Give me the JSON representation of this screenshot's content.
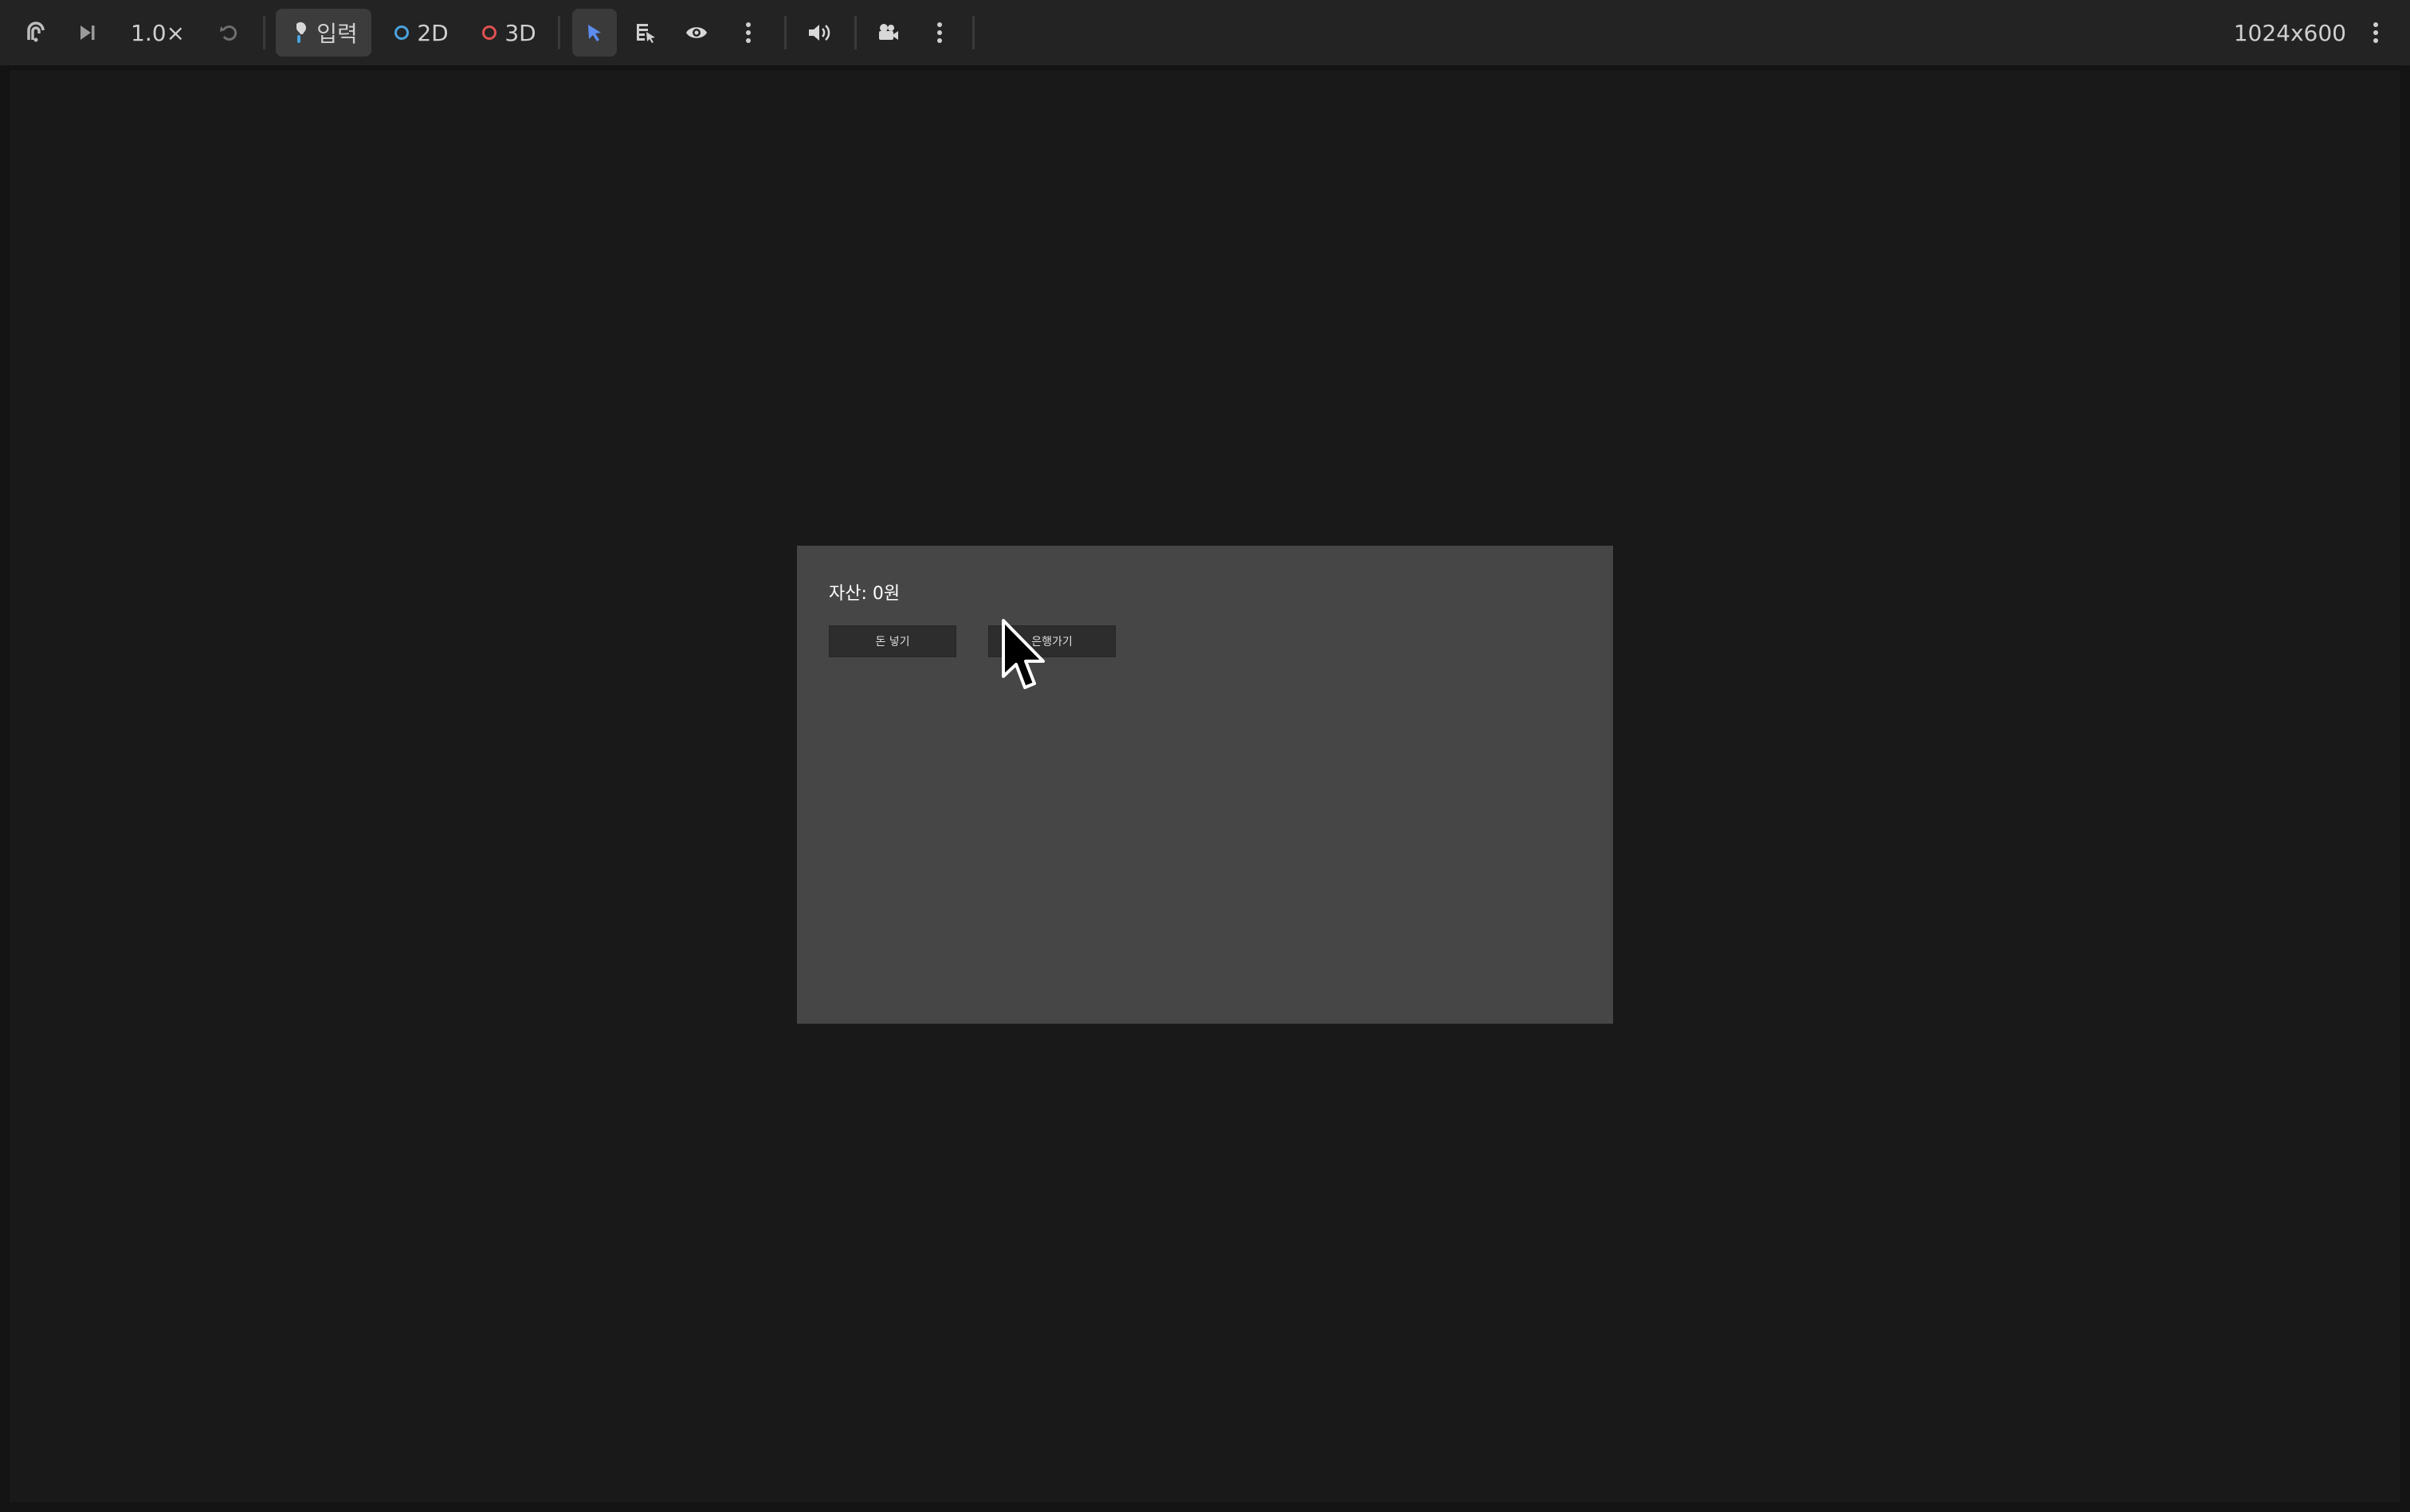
{
  "toolbar": {
    "speed_label": "1.0×",
    "input_label": "입력",
    "mode_2d_label": "2D",
    "mode_3d_label": "3D",
    "resolution_label": "1024x600",
    "icons": {
      "remote": "remote-debug-icon",
      "step": "step-forward-icon",
      "reset": "reset-icon",
      "input": "input-icon",
      "select": "select-pointer-icon",
      "list_select": "list-select-icon",
      "visibility": "eye-icon",
      "more1": "more-vertical-icon",
      "audio": "speaker-icon",
      "camera": "camera-icon",
      "more2": "more-vertical-icon",
      "more3": "more-vertical-icon"
    },
    "colors": {
      "mode_2d": "#4aa3df",
      "mode_3d": "#e05050",
      "select_active": "#5b8def"
    }
  },
  "game": {
    "money_label": "자산: 0원",
    "deposit_button": "돈 넣기",
    "bank_button": "은행가기"
  }
}
